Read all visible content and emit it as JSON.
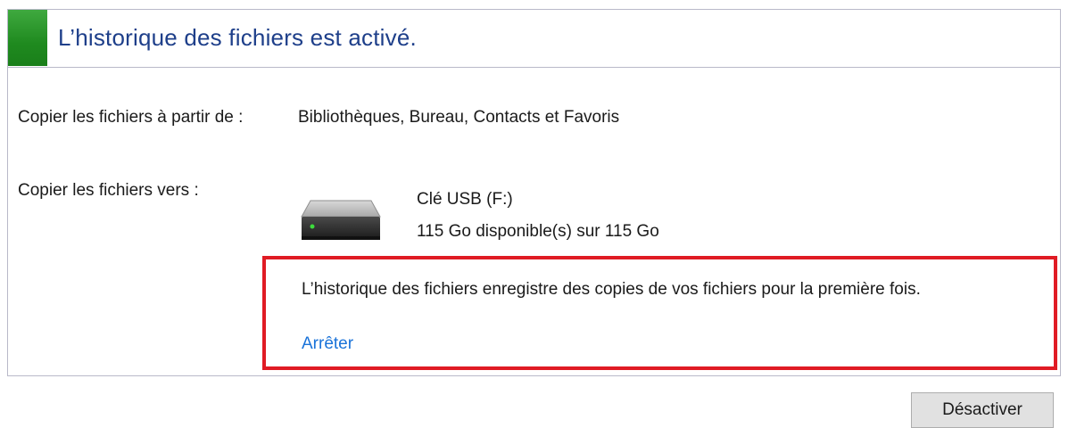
{
  "status": {
    "title": "L’historique des fichiers est activé.",
    "accent_color": "#2a9a2a"
  },
  "details": {
    "copy_from_label": "Copier les fichiers à partir de :",
    "copy_from_value": "Bibliothèques, Bureau, Contacts et Favoris",
    "copy_to_label": "Copier les fichiers vers :",
    "drive": {
      "icon": "hard-drive-icon",
      "name": "Clé USB (F:)",
      "space": "115 Go disponible(s) sur 115 Go"
    }
  },
  "notice": {
    "message": "L’historique des fichiers enregistre des copies de vos fichiers pour la première fois.",
    "link_label": "Arrêter",
    "highlight_color": "#e01b24"
  },
  "actions": {
    "disable_label": "Désactiver"
  }
}
